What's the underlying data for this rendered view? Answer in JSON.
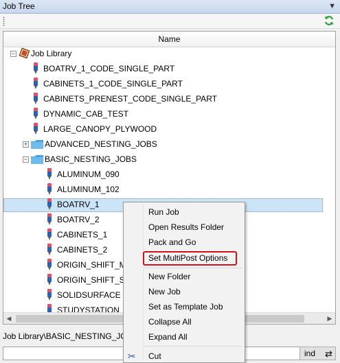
{
  "window": {
    "title": "Job Tree"
  },
  "tree": {
    "column_header": "Name",
    "rows": [
      {
        "label": "Job Library",
        "kind": "root"
      },
      {
        "label": "BOATRV_1_CODE_SINGLE_PART",
        "kind": "job"
      },
      {
        "label": "CABINETS_1_CODE_SINGLE_PART",
        "kind": "job"
      },
      {
        "label": "CABINETS_PRENEST_CODE_SINGLE_PART",
        "kind": "job"
      },
      {
        "label": "DYNAMIC_CAB_TEST",
        "kind": "job"
      },
      {
        "label": "LARGE_CANOPY_PLYWOOD",
        "kind": "job"
      },
      {
        "label": "ADVANCED_NESTING_JOBS",
        "kind": "folder"
      },
      {
        "label": "BASIC_NESTING_JOBS",
        "kind": "folder"
      },
      {
        "label": "ALUMINUM_090",
        "kind": "job"
      },
      {
        "label": "ALUMINUM_102",
        "kind": "job"
      },
      {
        "label": "BOATRV_1",
        "kind": "job"
      },
      {
        "label": "BOATRV_2",
        "kind": "job"
      },
      {
        "label": "CABINETS_1",
        "kind": "job"
      },
      {
        "label": "CABINETS_2",
        "kind": "job"
      },
      {
        "label": "ORIGIN_SHIFT_MA",
        "kind": "job"
      },
      {
        "label": "ORIGIN_SHIFT_SU",
        "kind": "job"
      },
      {
        "label": "SOLIDSURFACE",
        "kind": "job"
      },
      {
        "label": "STUDYSTATION",
        "kind": "job"
      }
    ],
    "selected": "BOATRV_1"
  },
  "status": {
    "path": "Job Library\\BASIC_NESTING_JOB"
  },
  "find_button": {
    "label": "ind"
  },
  "context_menu": {
    "items": [
      "Run Job",
      "Open Results Folder",
      "Pack and Go",
      "Set MultiPost Options",
      "New Folder",
      "New Job",
      "Set as Template Job",
      "Collapse All",
      "Expand All",
      "Cut"
    ],
    "highlighted": "Set MultiPost Options",
    "highlight_color": "#d3101a"
  },
  "colors": {
    "selection": "#cce4f7",
    "folder": "#4aa3df",
    "pin_head": "#e0506a",
    "pin_body": "#2a62b8"
  }
}
